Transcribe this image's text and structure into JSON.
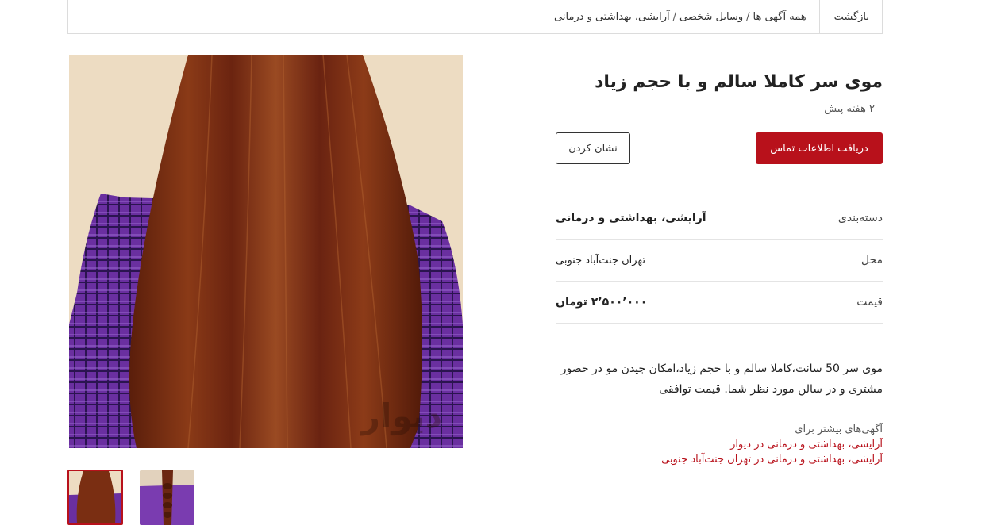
{
  "breadcrumb": {
    "back_label": "بازگشت",
    "path": [
      "همه آگهی ها",
      "وسایل شخصی",
      "آرایشی، بهداشتی و درمانی"
    ],
    "separator": "/"
  },
  "gallery": {
    "watermark": "دیوار",
    "thumbnail_count": 2,
    "active_index": 0
  },
  "listing": {
    "title": "موی سر کاملا سالم و با حجم زیاد",
    "posted_time": "۲ هفته پیش",
    "contact_button": "دریافت اطلاعات تماس",
    "mark_button": "نشان کردن",
    "details": [
      {
        "label": "دسته‌بندی",
        "value": "آرایشی، بهداشتی و درمانی"
      },
      {
        "label": "محل",
        "value": "تهران جنت‌آباد جنوبی"
      },
      {
        "label": "قیمت",
        "value": "۲٬۵۰۰٬۰۰۰ تومان"
      }
    ],
    "description": "موی سر 50 سانت،کاملا سالم و با حجم زیاد،امکان چیدن مو در حضور مشتری و در سالن مورد نظر شما. قیمت توافقی"
  },
  "more_ads": {
    "heading": "آگهی‌های بیشتر برای",
    "links": [
      "آرایشی، بهداشتی و درمانی در دیوار",
      "آرایشی، بهداشتی و درمانی در تهران جنت‌آباد جنوبی"
    ]
  },
  "colors": {
    "accent": "#b8111b",
    "hair": "#7a2e12",
    "shirt": "#6a2fa0",
    "background": "#efe0c8"
  }
}
